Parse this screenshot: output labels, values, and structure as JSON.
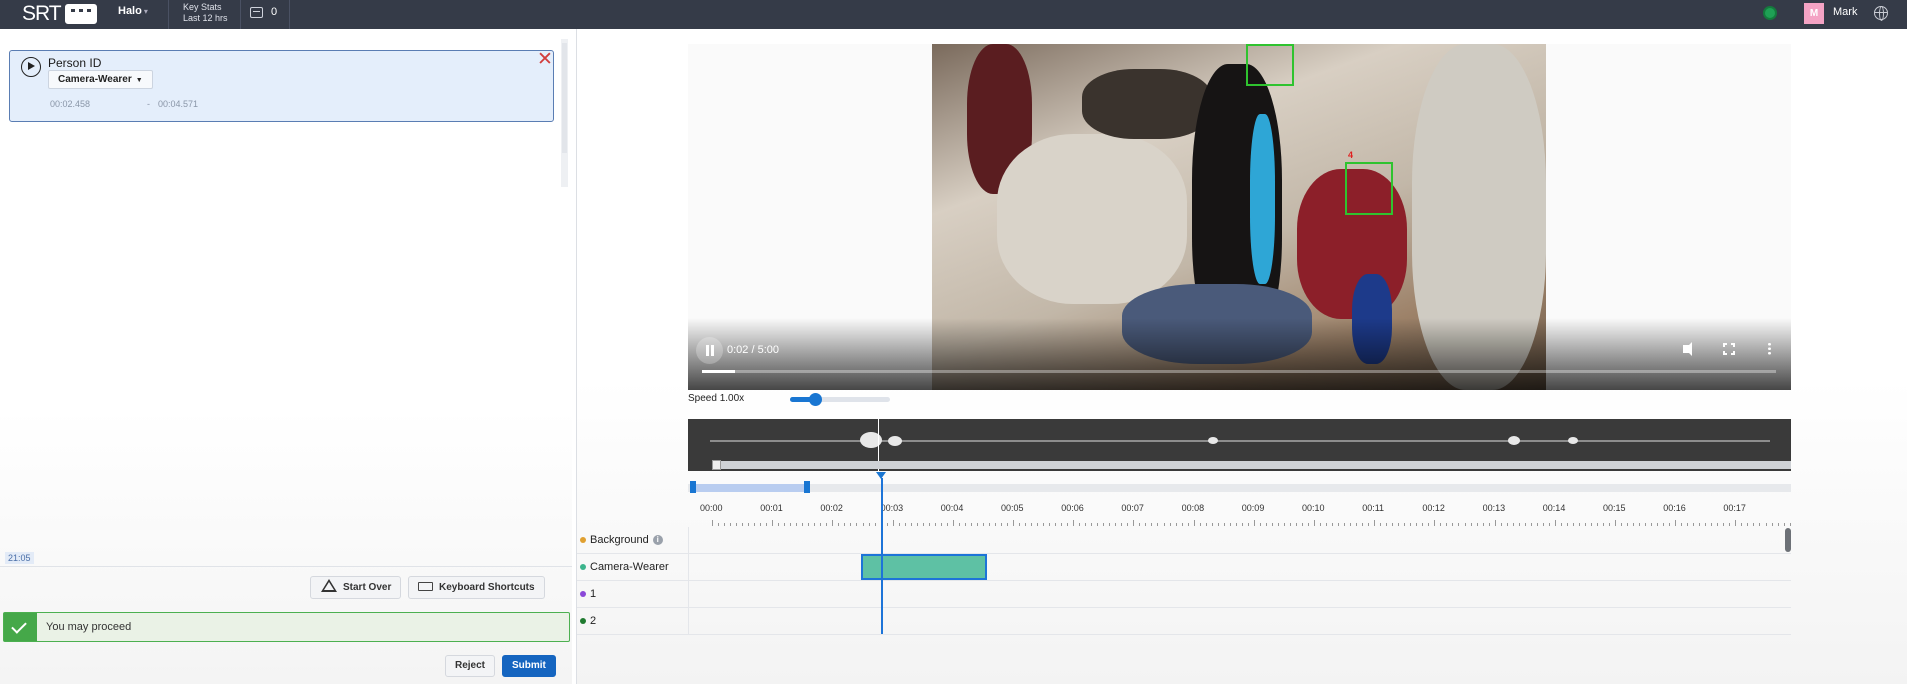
{
  "topbar": {
    "logo_text": "SRT",
    "logo_badge": "logo-badge",
    "project": "Halo",
    "project_suffix": "▾",
    "key_stats_line1": "Key Stats",
    "key_stats_line2": "Last 12 hrs",
    "tray_count": "0",
    "user_initial": "M",
    "user_name": "Mark",
    "status_color": "#1fa055"
  },
  "annotation_card": {
    "title": "Person ID",
    "label_select": "Camera-Wearer",
    "start_time": "00:02.458",
    "end_separator": "-",
    "end_time": "00:04.571"
  },
  "left_footer": {
    "clock": "21:05",
    "start_over_label": "Start Over",
    "keyboard_shortcuts_label": "Keyboard Shortcuts",
    "proceed_message": "You may proceed",
    "reject_label": "Reject",
    "submit_label": "Submit"
  },
  "video": {
    "time_display": "0:02 / 5:00",
    "progress_fraction": 0.007,
    "box_label": "4"
  },
  "speed": {
    "label": "Speed 1.00x",
    "value_fraction": 0.25
  },
  "timeline": {
    "ticks": [
      "00:00",
      "00:01",
      "00:02",
      "00:03",
      "00:04",
      "00:05",
      "00:06",
      "00:07",
      "00:08",
      "00:09",
      "00:10",
      "00:11",
      "00:12",
      "00:13",
      "00:14",
      "00:15",
      "00:16",
      "00:17"
    ],
    "zoom_range_fraction": [
      0.0,
      0.106
    ],
    "tracks": [
      {
        "label": "Background",
        "color": "#e0a030",
        "has_info": true
      },
      {
        "label": "Camera-Wearer",
        "color": "#3cb48c",
        "has_info": false
      },
      {
        "label": "1",
        "color": "#8a48d8",
        "has_info": false
      },
      {
        "label": "2",
        "color": "#1f7a2f",
        "has_info": false
      }
    ]
  },
  "colors": {
    "accent": "#1976d2",
    "segment": "#5ec1a4",
    "success": "#45a849",
    "close": "#d23c3c"
  }
}
